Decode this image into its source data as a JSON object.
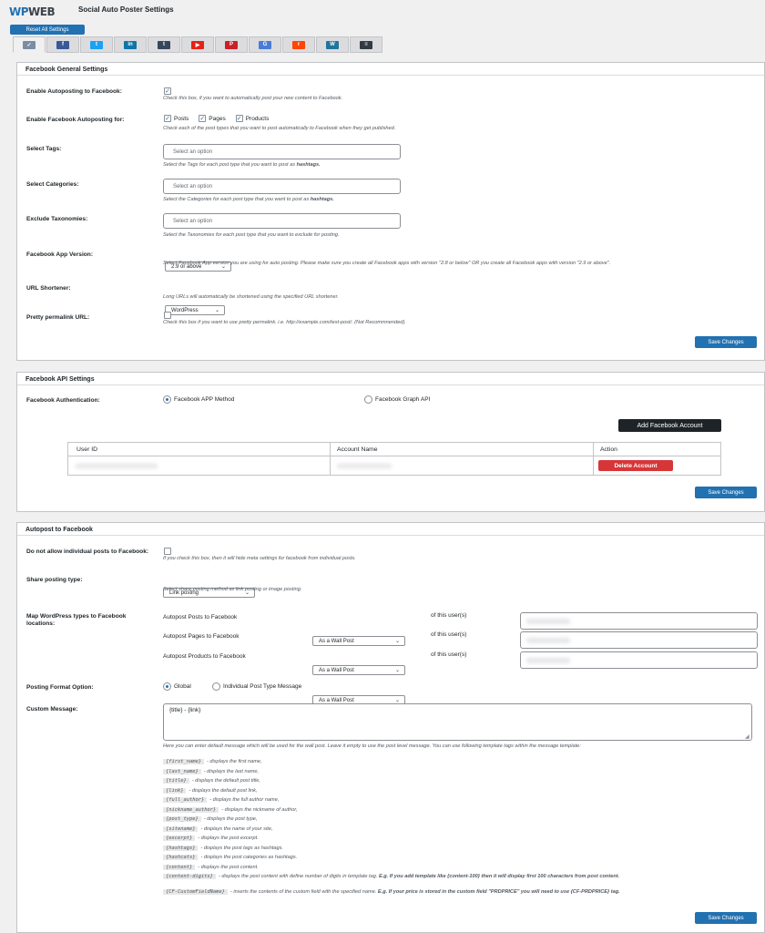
{
  "header": {
    "logo_wp": "WP",
    "logo_web": "WEB",
    "title": "Social Auto Poster Settings",
    "reset_label": "Reset All Settings"
  },
  "tabs": [
    {
      "icon": "social-auto-poster-icon",
      "color": "#7c8da3",
      "glyph": "✓"
    },
    {
      "icon": "facebook-icon",
      "color": "#3b5998",
      "glyph": "f"
    },
    {
      "icon": "twitter-icon",
      "color": "#1da1f2",
      "glyph": "t"
    },
    {
      "icon": "linkedin-icon",
      "color": "#0e76a8",
      "glyph": "in"
    },
    {
      "icon": "tumblr-icon",
      "color": "#36465d",
      "glyph": "t"
    },
    {
      "icon": "youtube-icon",
      "color": "#e62117",
      "glyph": "▶"
    },
    {
      "icon": "pinterest-icon",
      "color": "#cb2027",
      "glyph": "P"
    },
    {
      "icon": "google-business-icon",
      "color": "#4a7bd6",
      "glyph": "G"
    },
    {
      "icon": "reddit-icon",
      "color": "#ff4500",
      "glyph": "r"
    },
    {
      "icon": "wordpress-icon",
      "color": "#21759b",
      "glyph": "W"
    },
    {
      "icon": "buffer-icon",
      "color": "#323b43",
      "glyph": "≡"
    }
  ],
  "fb_general": {
    "title": "Facebook General Settings",
    "autopost_label": "Enable Autoposting to Facebook:",
    "autopost_desc": "Check this box, if you want to automatically post your new content to Facebook.",
    "types_label": "Enable Facebook Autoposting for:",
    "types": [
      "Posts",
      "Pages",
      "Products"
    ],
    "types_desc": "Check each of the post types that you want to post automatically to Facebook when they get published.",
    "tags_label": "Select Tags:",
    "tags_placeholder": "Select an option",
    "tags_desc": "Select the Tags for each post type that you want to post as",
    "tags_desc_bold": "hashtags.",
    "cats_label": "Select Categories:",
    "cats_placeholder": "Select an option",
    "cats_desc": "Select the Categories for each post type that you want to post as",
    "cats_desc_bold": "hashtags.",
    "excl_label": "Exclude Taxonomies:",
    "excl_placeholder": "Select an option",
    "excl_desc": "Select the Taxonomies for each post type that you want to exclude for posting.",
    "appver_label": "Facebook App Version:",
    "appver_value": "2.9 or above",
    "appver_desc": "Select Facebook App version you are using for auto posting. Please make sure you create all Facebook apps with version \"2.8 or below\" OR you create all Facebook apps with version \"2.9 or above\".",
    "short_label": "URL Shortener:",
    "short_value": "WordPress",
    "short_desc": "Long URLs will automatically be shortened using the specified URL shortener.",
    "pretty_label": "Pretty permalink URL:",
    "pretty_desc": "Check this box if you want to use pretty permalink. i.e. http://example.com/test-post/. (Not Recommnended).",
    "save": "Save Changes"
  },
  "fb_api": {
    "title": "Facebook API Settings",
    "auth_label": "Facebook Authentication:",
    "opt1": "Facebook APP Method",
    "opt2": "Facebook Graph API",
    "add_btn": "Add Facebook Account",
    "col_user": "User ID",
    "col_name": "Account Name",
    "col_action": "Action",
    "delete_btn": "Delete Account",
    "save": "Save Changes"
  },
  "autopost": {
    "title": "Autopost to Facebook",
    "noindiv_label": "Do not allow individual posts to Facebook:",
    "noindiv_desc": "If you check this box, then it will hide meta settings for facebook from individual posts.",
    "share_label": "Share posting type:",
    "share_value": "Link posting",
    "share_desc": "Select share posting method as link posting or image posting.",
    "map_label": "Map WordPress types to Facebook locations:",
    "map_rows": [
      {
        "label": "Autopost Posts to Facebook",
        "value": "As a Wall Post",
        "of": "of this user(s)"
      },
      {
        "label": "Autopost Pages to Facebook",
        "value": "As a Wall Post",
        "of": "of this user(s)"
      },
      {
        "label": "Autopost Products to Facebook",
        "value": "As a Wall Post",
        "of": "of this user(s)"
      }
    ],
    "format_label": "Posting Format Option:",
    "format_opt1": "Global",
    "format_opt2": "Individual Post Type Message",
    "custom_label": "Custom Message:",
    "custom_value": "{title} - {link}",
    "custom_desc": "Here you can enter default message which will be used for the wall post. Leave it empty to use the post level message. You can use following template tags within the message template:",
    "tags": [
      {
        "tag": "{first_name}",
        "desc": "- displays the first name,"
      },
      {
        "tag": "{last_name}",
        "desc": "- displays the last name,"
      },
      {
        "tag": "{title}",
        "desc": "- displays the default post title,"
      },
      {
        "tag": "{link}",
        "desc": "- displays the default post link,"
      },
      {
        "tag": "{full_author}",
        "desc": "- displays the full author name,"
      },
      {
        "tag": "{nickname_author}",
        "desc": "- displays the nickname of author,"
      },
      {
        "tag": "{post_type}",
        "desc": "- displays the post type,"
      },
      {
        "tag": "{sitename}",
        "desc": "- displays the name of your site,"
      },
      {
        "tag": "{excerpt}",
        "desc": "- displays the post excerpt."
      },
      {
        "tag": "{hashtags}",
        "desc": "- displays the post tags as hashtags."
      },
      {
        "tag": "{hashcats}",
        "desc": "- displays the post categories as hashtags."
      },
      {
        "tag": "{content}",
        "desc": "- displays the post content."
      }
    ],
    "digits_tag": "{content-digits}",
    "digits_desc": "- displays the post content with define number of digits in template tag.",
    "digits_bold": "E.g. If you add template like {content-100} then it will display first 100 characters from post content.",
    "cf_tag": "{CF-CustomFieldName}",
    "cf_desc": "- inserts the contents of the custom field with the specified name.",
    "cf_bold": "E.g. If your price is stored in the custom field \"PRDPRICE\" you will need to use {CF-PRDPRICE} tag.",
    "save": "Save Changes"
  }
}
